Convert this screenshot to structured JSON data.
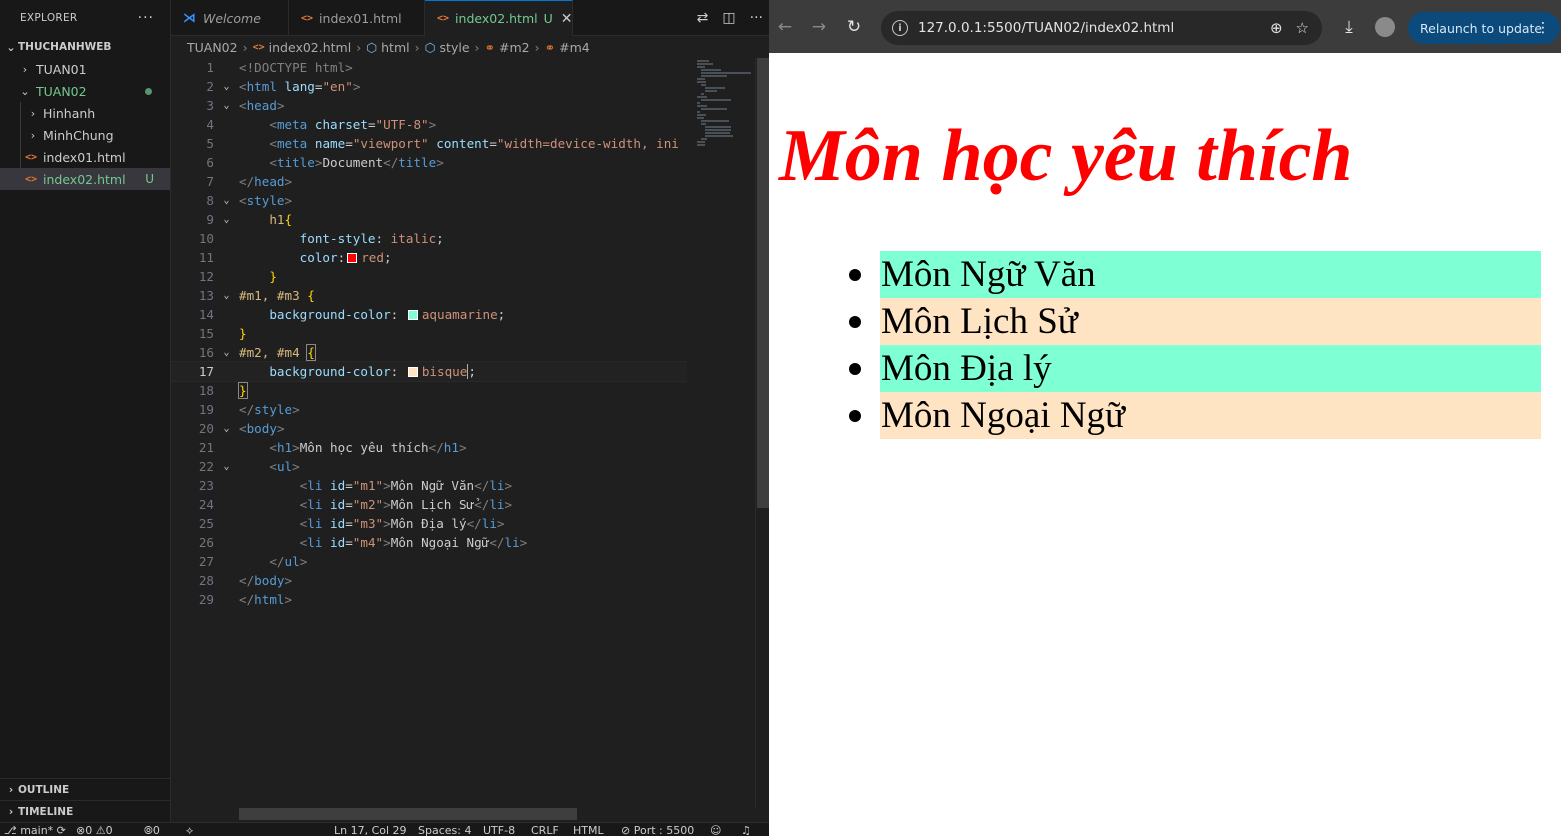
{
  "vscode": {
    "explorer": {
      "title": "EXPLORER",
      "more": "···",
      "root": "THUCHANHWEB",
      "items": [
        {
          "label": "TUAN01",
          "kind": "folder"
        },
        {
          "label": "TUAN02",
          "kind": "folder"
        },
        {
          "label": "Hinhanh",
          "kind": "folder"
        },
        {
          "label": "MinhChung",
          "kind": "folder"
        },
        {
          "label": "index01.html",
          "kind": "file"
        },
        {
          "label": "index02.html",
          "kind": "file",
          "badge": "U"
        }
      ],
      "outline": "OUTLINE",
      "timeline": "TIMELINE"
    },
    "tabs": [
      {
        "label": "Welcome"
      },
      {
        "label": "index01.html"
      },
      {
        "label": "index02.html",
        "badge": "U"
      }
    ],
    "breadcrumb": [
      "TUAN02",
      "index02.html",
      "html",
      "style",
      "#m2",
      "#m4"
    ],
    "code": [
      {
        "n": "1"
      },
      {
        "n": "2"
      },
      {
        "n": "3"
      },
      {
        "n": "4"
      },
      {
        "n": "5"
      },
      {
        "n": "6"
      },
      {
        "n": "7"
      },
      {
        "n": "8"
      },
      {
        "n": "9"
      },
      {
        "n": "10"
      },
      {
        "n": "11"
      },
      {
        "n": "12"
      },
      {
        "n": "13"
      },
      {
        "n": "14"
      },
      {
        "n": "15"
      },
      {
        "n": "16"
      },
      {
        "n": "17"
      },
      {
        "n": "18"
      },
      {
        "n": "19"
      },
      {
        "n": "20"
      },
      {
        "n": "21"
      },
      {
        "n": "22"
      },
      {
        "n": "23"
      },
      {
        "n": "24"
      },
      {
        "n": "25"
      },
      {
        "n": "26"
      },
      {
        "n": "27"
      },
      {
        "n": "28"
      },
      {
        "n": "29"
      }
    ],
    "code_text": {
      "doctype": "<!DOCTYPE html>",
      "lang_val": "\"en\"",
      "charset_val": "\"UTF-8\"",
      "viewport_val": "\"viewport\"",
      "content_val": "\"width=device-width, ini",
      "doc_title": "Document",
      "sel_h1": "h1",
      "prop_font_style": "font-style",
      "val_italic": "italic",
      "prop_color": "color",
      "val_red": "red",
      "sel_m1m3": "#m1, #m3",
      "prop_bg": "background-color",
      "val_aqua": "aquamarine",
      "sel_m2m4": "#m2, #m4",
      "val_bisque": "bisque",
      "h1_text": "Môn học yêu thích",
      "li1_id": "\"m1\"",
      "li1_text": "Môn Ngữ Văn",
      "li2_id": "\"m2\"",
      "li2_text": "Môn Lịch Sử",
      "li3_id": "\"m3\"",
      "li3_text": "Môn Địa lý",
      "li4_id": "\"m4\"",
      "li4_text": "Môn Ngoại Ngữ"
    },
    "statusbar": {
      "branch": "main*",
      "problems": "0",
      "warnings": "0",
      "ports": "0",
      "cursor": "Ln 17, Col 29",
      "spaces": "Spaces: 4",
      "encoding": "UTF-8",
      "eol": "CRLF",
      "language": "HTML",
      "port": "Port : 5500"
    },
    "colors": {
      "red": "#ff0000",
      "aquamarine": "#7fffd4",
      "bisque": "#ffe4c4"
    }
  },
  "browser": {
    "url": "127.0.0.1:5500/TUAN02/index02.html",
    "relaunch": "Relaunch to update",
    "page": {
      "h1": "Môn học yêu thích",
      "items": [
        {
          "text": "Môn Ngữ Văn",
          "bg": "#7fffd4"
        },
        {
          "text": "Môn Lịch Sử",
          "bg": "#ffe4c4"
        },
        {
          "text": "Môn Địa lý",
          "bg": "#7fffd4"
        },
        {
          "text": "Môn Ngoại Ngữ",
          "bg": "#ffe4c4"
        }
      ]
    }
  }
}
